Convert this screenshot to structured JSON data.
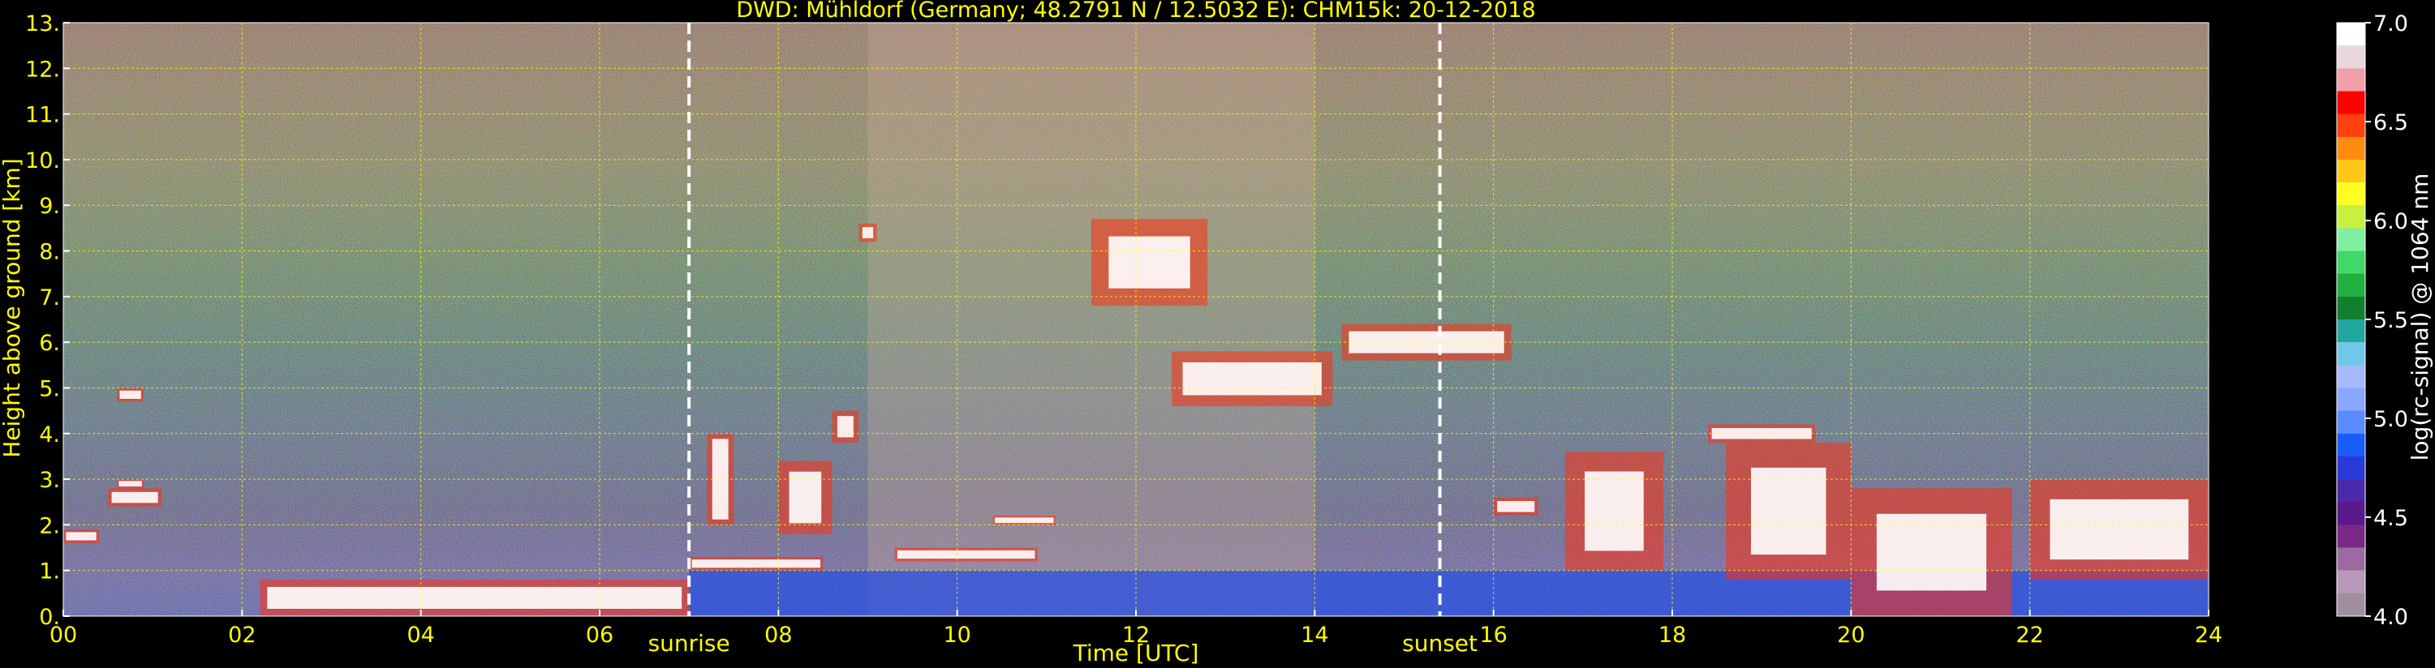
{
  "chart_data": {
    "type": "heatmap",
    "title": "DWD: Mühldorf (Germany; 48.2791 N / 12.5032 E):    CHM15k: 20-12-2018",
    "xlabel": "Time [UTC]",
    "ylabel": "Height above ground [km]",
    "xlim": [
      0,
      24
    ],
    "ylim": [
      0,
      13
    ],
    "x_ticks": [
      0,
      2,
      4,
      6,
      8,
      10,
      12,
      14,
      16,
      18,
      20,
      22,
      24
    ],
    "x_tick_labels": [
      "00",
      "02",
      "04",
      "06",
      "08",
      "10",
      "12",
      "14",
      "16",
      "18",
      "20",
      "22",
      "24"
    ],
    "y_ticks": [
      0,
      1,
      2,
      3,
      4,
      5,
      6,
      7,
      8,
      9,
      10,
      11,
      12,
      13
    ],
    "y_tick_labels": [
      "0.",
      "1.",
      "2.",
      "3.",
      "4.",
      "5.",
      "6.",
      "7.",
      "8.",
      "9.",
      "10.",
      "11.",
      "12.",
      "13."
    ],
    "grid": true,
    "colorbar": {
      "label": "log(rc-signal) @ 1064 nm",
      "range": [
        4.0,
        7.0
      ],
      "ticks": [
        4.0,
        4.5,
        5.0,
        5.5,
        6.0,
        6.5,
        7.0
      ],
      "tick_labels": [
        "4.0",
        "4.5",
        "5.0",
        "5.5",
        "6.0",
        "6.5",
        "7.0"
      ],
      "colors": [
        "#a08fa0",
        "#b89ab8",
        "#9c6aa0",
        "#7a2a86",
        "#5a1a8c",
        "#4a2aa8",
        "#2a3ad8",
        "#1a5cff",
        "#5a8cff",
        "#8aa8ff",
        "#a8b8ff",
        "#70c8e8",
        "#20a8a0",
        "#108030",
        "#20b040",
        "#40d868",
        "#80f0a0",
        "#c8f040",
        "#ffff20",
        "#ffc818",
        "#ff8c10",
        "#ff4010",
        "#ff0000",
        "#f0a0a8",
        "#e8d8dc",
        "#ffffff"
      ]
    },
    "events": [
      {
        "label": "sunrise",
        "time": 7.0
      },
      {
        "label": "sunset",
        "time": 15.4
      }
    ],
    "cloud_layers": [
      {
        "t0": 0.0,
        "t1": 0.4,
        "h0": 1.6,
        "h1": 1.9
      },
      {
        "t0": 0.5,
        "t1": 1.1,
        "h0": 2.4,
        "h1": 2.8
      },
      {
        "t0": 0.6,
        "t1": 0.9,
        "h0": 2.8,
        "h1": 3.0
      },
      {
        "t0": 0.6,
        "t1": 0.9,
        "h0": 4.7,
        "h1": 5.0
      },
      {
        "t0": 2.2,
        "t1": 7.0,
        "h0": 0.0,
        "h1": 0.8
      },
      {
        "t0": 7.0,
        "t1": 8.5,
        "h0": 1.0,
        "h1": 1.3
      },
      {
        "t0": 7.2,
        "t1": 7.5,
        "h0": 2.0,
        "h1": 4.0
      },
      {
        "t0": 8.0,
        "t1": 8.6,
        "h0": 1.8,
        "h1": 3.4
      },
      {
        "t0": 8.6,
        "t1": 8.9,
        "h0": 3.8,
        "h1": 4.5
      },
      {
        "t0": 8.9,
        "t1": 9.1,
        "h0": 8.2,
        "h1": 8.6
      },
      {
        "t0": 9.3,
        "t1": 10.9,
        "h0": 1.2,
        "h1": 1.5
      },
      {
        "t0": 10.4,
        "t1": 11.1,
        "h0": 2.0,
        "h1": 2.2
      },
      {
        "t0": 11.5,
        "t1": 12.8,
        "h0": 6.8,
        "h1": 8.7
      },
      {
        "t0": 12.4,
        "t1": 14.2,
        "h0": 4.6,
        "h1": 5.8
      },
      {
        "t0": 14.3,
        "t1": 16.2,
        "h0": 5.6,
        "h1": 6.4
      },
      {
        "t0": 16.0,
        "t1": 16.5,
        "h0": 2.2,
        "h1": 2.6
      },
      {
        "t0": 16.8,
        "t1": 17.9,
        "h0": 1.0,
        "h1": 3.6
      },
      {
        "t0": 18.4,
        "t1": 19.6,
        "h0": 3.8,
        "h1": 4.2
      },
      {
        "t0": 18.6,
        "t1": 20.0,
        "h0": 0.8,
        "h1": 3.8
      },
      {
        "t0": 20.0,
        "t1": 21.8,
        "h0": 0.0,
        "h1": 2.8
      },
      {
        "t0": 22.0,
        "t1": 24.0,
        "h0": 0.8,
        "h1": 3.0
      }
    ]
  }
}
